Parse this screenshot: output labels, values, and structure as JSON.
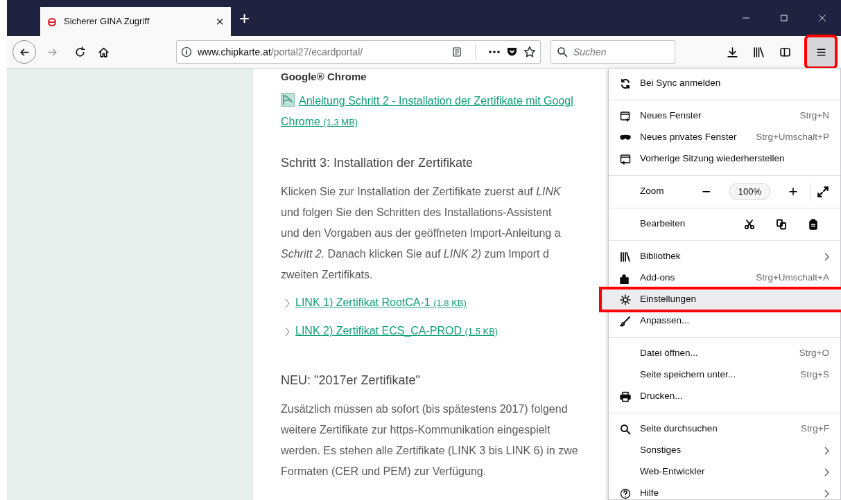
{
  "tab": {
    "title": "Sicherer GINA Zugriff",
    "selected": true,
    "close": "×"
  },
  "new_tab_button": "+",
  "toolbar": {
    "url_domain": "www.chipkarte.at",
    "url_path": "/portal27/ecardportal/",
    "search_placeholder": "Suchen",
    "menu_button": {
      "pressed": true,
      "highlighted": true
    }
  },
  "page": {
    "cut_heading": "Google® Chrome",
    "guide_link": {
      "lines": [
        "Anleitung Schritt 2 - Installation der Zertifikate mit Googl",
        "Chrome"
      ],
      "size": "(1.3 MB)"
    },
    "sections": [
      {
        "heading": "Schritt 3: Installation der Zertifikate",
        "paragraph": [
          "Klicken Sie zur Installation der Zertifikate zuerst auf *LINK*",
          "und folgen Sie den Schritten des Installations-Assistent",
          "und den Vorgaben aus der geöffneten Import-Anleitung a",
          "*Schritt 2.* Danach klicken Sie auf *LINK 2)* zum Import d",
          "zweiten Zertifikats."
        ],
        "links": [
          {
            "label": "LINK 1) Zertifikat RootCA-1",
            "size": "(1.8 KB)"
          },
          {
            "label": "LINK 2) Zertifikat ECS_CA-PROD",
            "size": "(1.5 KB)"
          }
        ]
      },
      {
        "heading": "NEU: \"2017er Zertifikate\"",
        "paragraph": [
          "Zusätzlich müssen ab sofort (bis spätestens 2017) folgend",
          "weitere Zertifikate zur https-Kommunikation eingespielt",
          "werden. Es stehen alle Zertifikate (LINK 3 bis LINK 6) in zwe",
          "Formaten (CER und PEM) zur Verfügung."
        ]
      }
    ]
  },
  "menu": {
    "items": [
      {
        "kind": "item",
        "label": "Bei Sync anmelden",
        "submenu": false,
        "selected": false,
        "highlighted": false
      },
      {
        "kind": "separator"
      },
      {
        "kind": "item",
        "label": "Neues Fenster",
        "shortcut": "Strg+N",
        "submenu": false,
        "selected": false,
        "highlighted": false
      },
      {
        "kind": "item",
        "label": "Neues privates Fenster",
        "shortcut": "Strg+Umschalt+P",
        "submenu": false,
        "selected": false,
        "highlighted": false
      },
      {
        "kind": "item",
        "label": "Vorherige Sitzung wiederherstellen",
        "submenu": false,
        "selected": false,
        "highlighted": false
      },
      {
        "kind": "separator"
      },
      {
        "kind": "zoom",
        "label": "Zoom",
        "minus": "−",
        "value": "100%",
        "plus": "+"
      },
      {
        "kind": "separator"
      },
      {
        "kind": "edit",
        "label": "Bearbeiten"
      },
      {
        "kind": "separator"
      },
      {
        "kind": "item",
        "label": "Bibliothek",
        "submenu": true,
        "selected": false,
        "highlighted": false
      },
      {
        "kind": "item",
        "label": "Add-ons",
        "shortcut": "Strg+Umschalt+A",
        "submenu": false,
        "selected": false,
        "highlighted": false
      },
      {
        "kind": "item",
        "label": "Einstellungen",
        "submenu": false,
        "selected": true,
        "highlighted": true
      },
      {
        "kind": "item",
        "label": "Anpassen...",
        "submenu": false,
        "selected": false,
        "highlighted": false
      },
      {
        "kind": "separator"
      },
      {
        "kind": "item",
        "label": "Datei öffnen...",
        "shortcut": "Strg+O",
        "submenu": false,
        "selected": false,
        "highlighted": false
      },
      {
        "kind": "item",
        "label": "Seite speichern unter...",
        "shortcut": "Strg+S",
        "submenu": false,
        "selected": false,
        "highlighted": false
      },
      {
        "kind": "item",
        "label": "Drucken...",
        "submenu": false,
        "selected": false,
        "highlighted": false
      },
      {
        "kind": "separator"
      },
      {
        "kind": "item",
        "label": "Seite durchsuchen",
        "shortcut": "Strg+F",
        "submenu": false,
        "selected": false,
        "highlighted": false
      },
      {
        "kind": "item",
        "label": "Sonstiges",
        "submenu": true,
        "selected": false,
        "highlighted": false
      },
      {
        "kind": "item",
        "label": "Web-Entwickler",
        "submenu": true,
        "selected": false,
        "highlighted": false
      },
      {
        "kind": "item",
        "label": "Hilfe",
        "submenu": true,
        "selected": false,
        "highlighted": false
      }
    ]
  }
}
